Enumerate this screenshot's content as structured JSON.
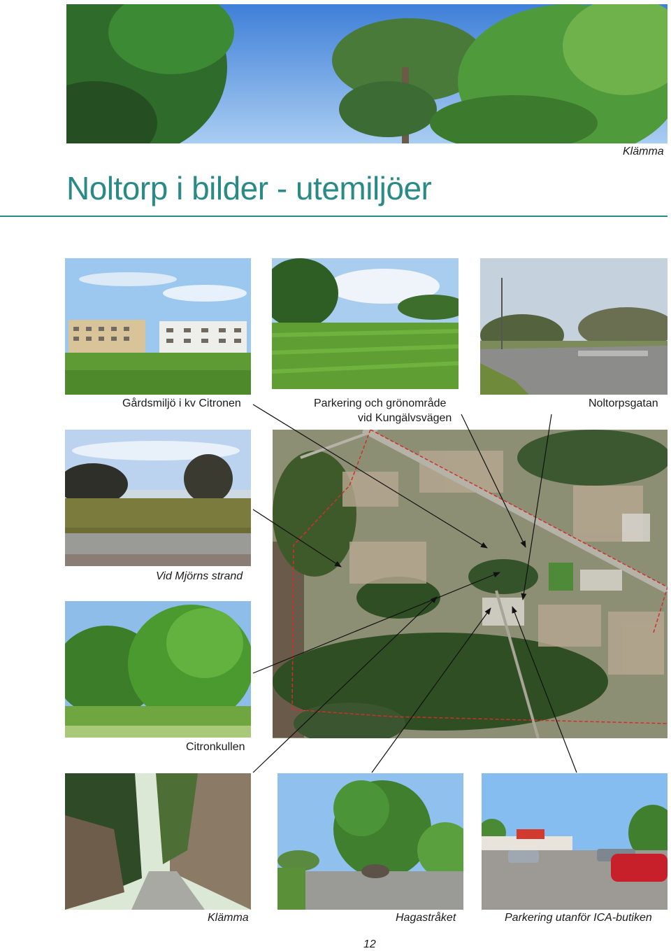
{
  "page": {
    "title": "Noltorp i bilder - utemiljöer",
    "top_photo_caption": "Klämma",
    "page_number": "12"
  },
  "captions": {
    "gardsmiljo": "Gårdsmiljö i kv Citronen",
    "parkering_line1": "Parkering och grönområde",
    "parkering_line2": "vid Kungälvsvägen",
    "noltorpsgatan": "Noltorpsgatan",
    "mjorn": "Vid Mjörns strand",
    "citronkullen": "Citronkullen",
    "klamma": "Klämma",
    "hagastraket": "Hagastråket",
    "ica": "Parkering utanför ICA-butiken"
  },
  "colors": {
    "accent": "#2a8a86",
    "boundary": "#d0302a"
  }
}
